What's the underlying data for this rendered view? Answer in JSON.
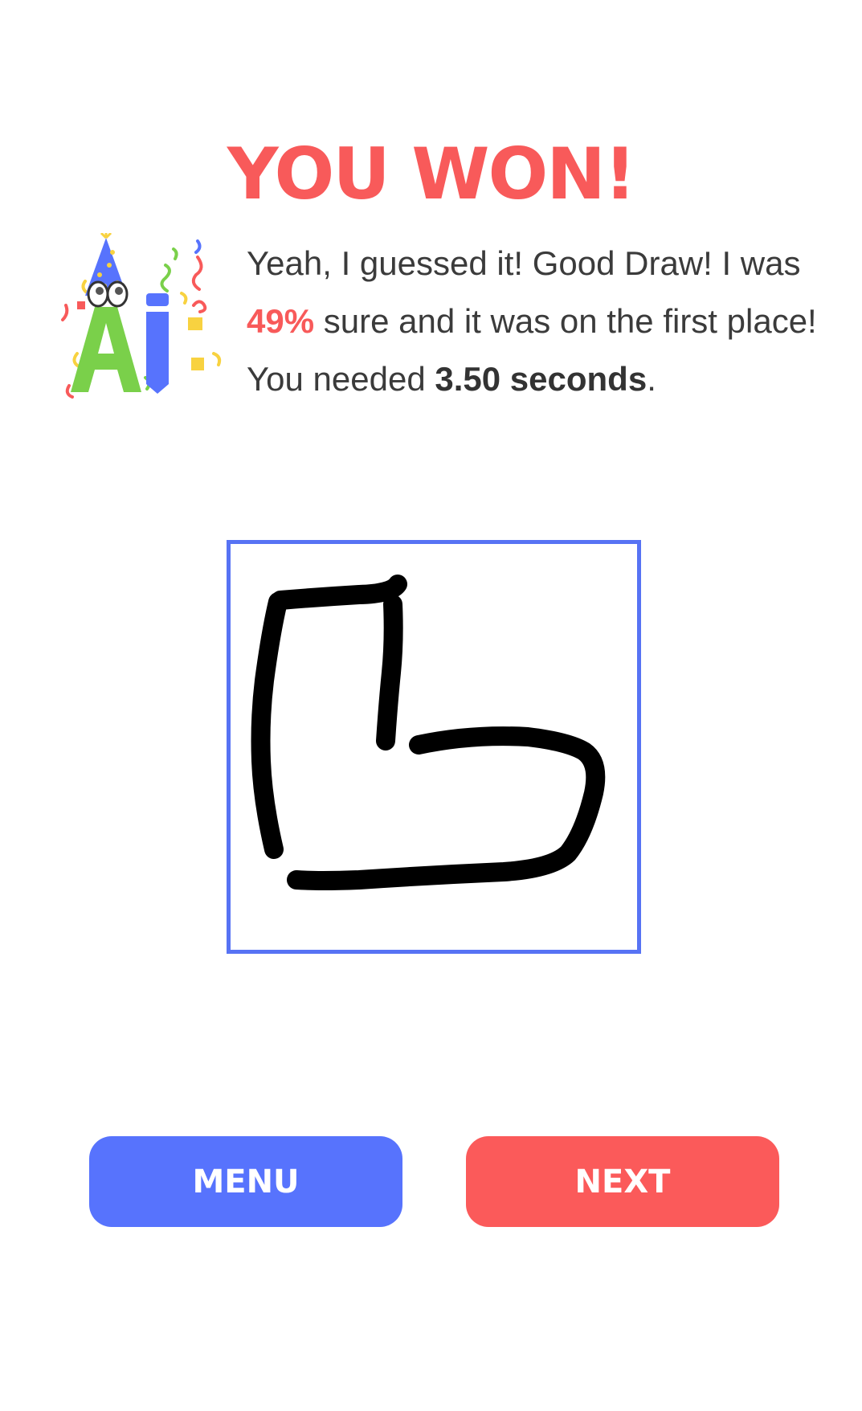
{
  "result": {
    "title": "YOU WON!"
  },
  "message": {
    "line1_pre": "Yeah, I guessed it! Good Draw! I was ",
    "confidence": "49%",
    "line1_post": " sure and it was on the first place!",
    "time_pre": "You needed ",
    "time_value": "3.50 seconds",
    "time_post": "."
  },
  "mascot": {
    "icon": "ai-pencil-party-mascot-icon",
    "letters": "Ai"
  },
  "drawing": {
    "stroke_color": "#000000",
    "frame_color": "#5773f4"
  },
  "buttons": {
    "menu_label": "MENU",
    "next_label": "NEXT"
  },
  "colors": {
    "accent_red": "#f85a5a",
    "accent_blue": "#5773fd"
  }
}
